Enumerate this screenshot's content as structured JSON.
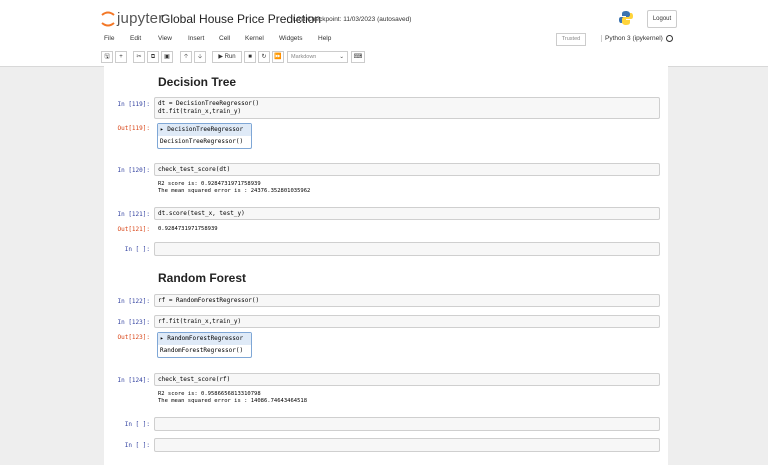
{
  "header": {
    "brand": "jupyter",
    "notebook_title": "Global House Price Prediction",
    "checkpoint": "Last Checkpoint: 11/03/2023  (autosaved)",
    "logout_label": "Logout",
    "trusted_label": "Trusted",
    "kernel_label": "Python 3 (ipykernel)"
  },
  "menu": [
    "File",
    "Edit",
    "View",
    "Insert",
    "Cell",
    "Kernel",
    "Widgets",
    "Help"
  ],
  "toolbar": {
    "run_label": "▶ Run",
    "cell_type": "Markdown"
  },
  "sections": {
    "decision_tree": "Decision Tree",
    "random_forest": "Random Forest"
  },
  "cells": {
    "c119": {
      "in_prompt": "In [119]:",
      "code_line1": "dt = DecisionTreeRegressor()",
      "code_line2": "dt.fit(train_x,train_y)",
      "out_prompt": "Out[119]:",
      "est_head": "▸ DecisionTreeRegressor",
      "est_body": "DecisionTreeRegressor()"
    },
    "c120": {
      "in_prompt": "In [120]:",
      "code": "check_test_score(dt)",
      "out_line1": "R2 score is: 0.9284731971758939",
      "out_line2": "The mean squared error is : 24376.352801035962"
    },
    "c121": {
      "in_prompt": "In [121]:",
      "code": "dt.score(test_x, test_y)",
      "out_prompt": "Out[121]:",
      "out": "0.9284731971758939"
    },
    "empty1": {
      "in_prompt": "In [ ]:"
    },
    "c122": {
      "in_prompt": "In [122]:",
      "code": "rf = RandomForestRegressor()"
    },
    "c123": {
      "in_prompt": "In [123]:",
      "code": "rf.fit(train_x,train_y)",
      "out_prompt": "Out[123]:",
      "est_head": "▸ RandomForestRegressor",
      "est_body": "RandomForestRegressor()"
    },
    "c124": {
      "in_prompt": "In [124]:",
      "code": "check_test_score(rf)",
      "out_line1": "R2 score is: 0.9586656813310798",
      "out_line2": "The mean squared error is : 14086.74643464518"
    },
    "empty2": {
      "in_prompt": "In [ ]:"
    },
    "empty3": {
      "in_prompt": "In [ ]:"
    }
  },
  "colors": {
    "in_prompt": "#303f9f",
    "out_prompt": "#d84315",
    "jupyter_orange": "#f37726"
  }
}
